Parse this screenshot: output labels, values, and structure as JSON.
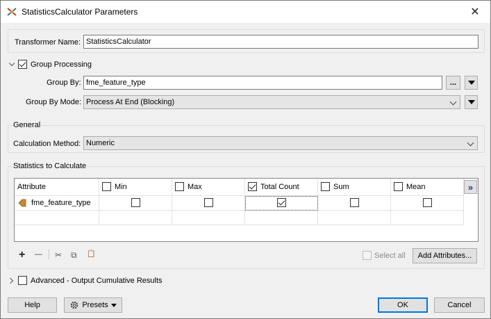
{
  "window": {
    "title": "StatisticsCalculator Parameters",
    "close_label": "✕"
  },
  "transformer_name": {
    "label": "Transformer Name:",
    "value": "StatisticsCalculator"
  },
  "group_processing": {
    "label": "Group Processing",
    "checked": true,
    "group_by": {
      "label": "Group By:",
      "value": "fme_feature_type",
      "browse_label": "..."
    },
    "group_by_mode": {
      "label": "Group By Mode:",
      "value": "Process At End (Blocking)"
    }
  },
  "general": {
    "legend": "General",
    "calculation_method": {
      "label": "Calculation Method:",
      "value": "Numeric"
    }
  },
  "statistics": {
    "legend": "Statistics to Calculate",
    "columns": [
      {
        "label": "Attribute",
        "has_checkbox": false
      },
      {
        "label": "Min",
        "has_checkbox": true,
        "checked": false
      },
      {
        "label": "Max",
        "has_checkbox": true,
        "checked": false
      },
      {
        "label": "Total Count",
        "has_checkbox": true,
        "checked": true
      },
      {
        "label": "Sum",
        "has_checkbox": true,
        "checked": false
      },
      {
        "label": "Mean",
        "has_checkbox": true,
        "checked": false
      }
    ],
    "more_columns_label": "»",
    "rows": [
      {
        "attribute": "fme_feature_type",
        "min": false,
        "max": false,
        "total_count": true,
        "sum": false,
        "mean": false
      }
    ],
    "toolbar": {
      "add": "+",
      "remove": "—",
      "cut": "✂",
      "copy": "⧉",
      "paste": "📋"
    },
    "select_all_label": "Select all",
    "add_attributes_label": "Add Attributes..."
  },
  "advanced": {
    "label": "Advanced - Output Cumulative Results",
    "checked": false
  },
  "footer": {
    "help": "Help",
    "presets": "Presets",
    "ok": "OK",
    "cancel": "Cancel"
  },
  "colors": {
    "accent": "#0078d7",
    "attribute_icon": "#c8872f"
  }
}
